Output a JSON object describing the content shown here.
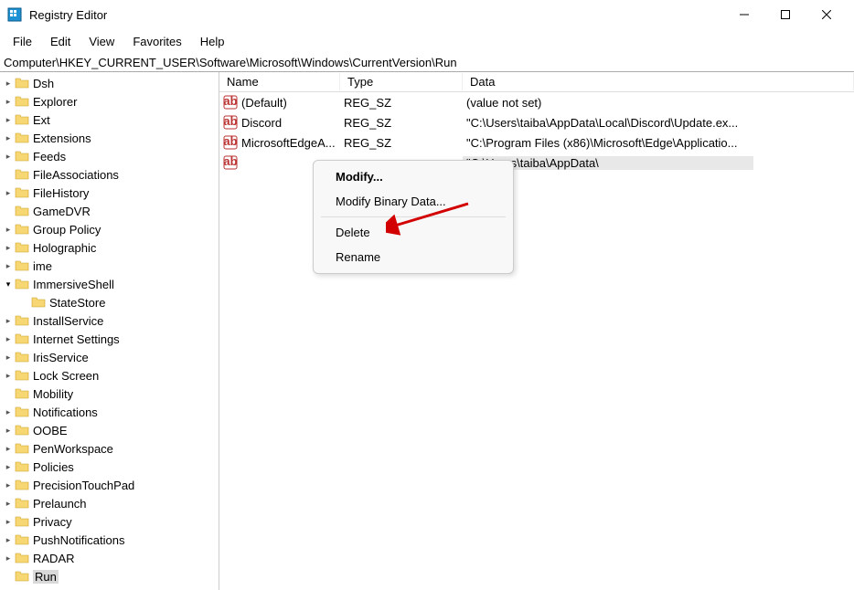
{
  "window": {
    "title": "Registry Editor"
  },
  "menu": {
    "items": [
      "File",
      "Edit",
      "View",
      "Favorites",
      "Help"
    ]
  },
  "address": {
    "path": "Computer\\HKEY_CURRENT_USER\\Software\\Microsoft\\Windows\\CurrentVersion\\Run"
  },
  "tree": {
    "items": [
      {
        "label": "Dsh",
        "expanded": false,
        "chev": true
      },
      {
        "label": "Explorer",
        "expanded": false,
        "chev": true
      },
      {
        "label": "Ext",
        "expanded": false,
        "chev": true
      },
      {
        "label": "Extensions",
        "expanded": false,
        "chev": true
      },
      {
        "label": "Feeds",
        "expanded": false,
        "chev": true
      },
      {
        "label": "FileAssociations",
        "expanded": false,
        "chev": false
      },
      {
        "label": "FileHistory",
        "expanded": false,
        "chev": true
      },
      {
        "label": "GameDVR",
        "expanded": false,
        "chev": false
      },
      {
        "label": "Group Policy",
        "expanded": false,
        "chev": true
      },
      {
        "label": "Holographic",
        "expanded": false,
        "chev": true
      },
      {
        "label": "ime",
        "expanded": false,
        "chev": true
      },
      {
        "label": "ImmersiveShell",
        "expanded": true,
        "chev": true,
        "children": [
          {
            "label": "StateStore"
          }
        ]
      },
      {
        "label": "InstallService",
        "expanded": false,
        "chev": true
      },
      {
        "label": "Internet Settings",
        "expanded": false,
        "chev": true
      },
      {
        "label": "IrisService",
        "expanded": false,
        "chev": true
      },
      {
        "label": "Lock Screen",
        "expanded": false,
        "chev": true
      },
      {
        "label": "Mobility",
        "expanded": false,
        "chev": false
      },
      {
        "label": "Notifications",
        "expanded": false,
        "chev": true
      },
      {
        "label": "OOBE",
        "expanded": false,
        "chev": true
      },
      {
        "label": "PenWorkspace",
        "expanded": false,
        "chev": true
      },
      {
        "label": "Policies",
        "expanded": false,
        "chev": true
      },
      {
        "label": "PrecisionTouchPad",
        "expanded": false,
        "chev": true
      },
      {
        "label": "Prelaunch",
        "expanded": false,
        "chev": true
      },
      {
        "label": "Privacy",
        "expanded": false,
        "chev": true
      },
      {
        "label": "PushNotifications",
        "expanded": false,
        "chev": true
      },
      {
        "label": "RADAR",
        "expanded": false,
        "chev": true
      },
      {
        "label": "Run",
        "expanded": false,
        "chev": false,
        "selected": true
      }
    ]
  },
  "list": {
    "columns": {
      "name": "Name",
      "type": "Type",
      "data": "Data"
    },
    "rows": [
      {
        "name": "(Default)",
        "type": "REG_SZ",
        "data": "(value not set)"
      },
      {
        "name": "Discord",
        "type": "REG_SZ",
        "data": "\"C:\\Users\\taiba\\AppData\\Local\\Discord\\Update.ex..."
      },
      {
        "name": "MicrosoftEdgeA...",
        "type": "REG_SZ",
        "data": "\"C:\\Program Files (x86)\\Microsoft\\Edge\\Applicatio..."
      },
      {
        "name": "",
        "type": "",
        "data": "\"C:\\Users\\taiba\\AppData\\",
        "selected": true
      }
    ]
  },
  "context_menu": {
    "items": [
      {
        "label": "Modify...",
        "bold": true
      },
      {
        "label": "Modify Binary Data..."
      },
      {
        "sep": true
      },
      {
        "label": "Delete"
      },
      {
        "label": "Rename"
      }
    ]
  }
}
